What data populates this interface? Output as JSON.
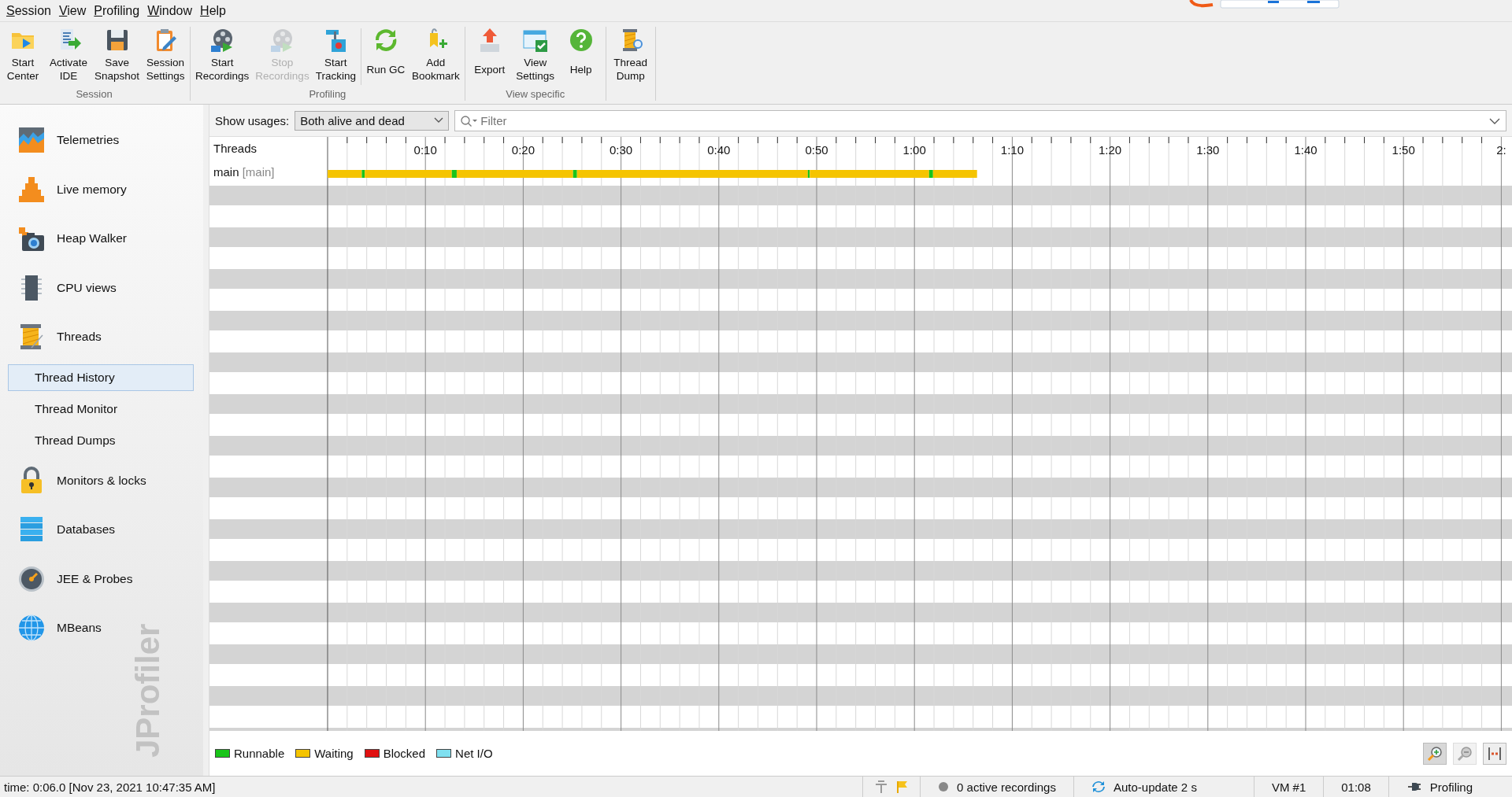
{
  "menu": [
    {
      "label": "Session"
    },
    {
      "label": "View"
    },
    {
      "label": "Profiling"
    },
    {
      "label": "Window"
    },
    {
      "label": "Help"
    }
  ],
  "toolbar": {
    "groups": [
      {
        "label": "Session",
        "buttons": [
          {
            "lines": [
              "Start",
              "Center"
            ],
            "disabled": false
          },
          {
            "lines": [
              "Activate",
              "IDE"
            ],
            "disabled": false
          },
          {
            "lines": [
              "Save",
              "Snapshot"
            ],
            "disabled": false
          },
          {
            "lines": [
              "Session",
              "Settings"
            ],
            "disabled": false
          }
        ]
      },
      {
        "label": "Profiling",
        "buttons": [
          {
            "lines": [
              "Start",
              "Recordings"
            ],
            "disabled": false
          },
          {
            "lines": [
              "Stop",
              "Recordings"
            ],
            "disabled": true
          },
          {
            "lines": [
              "Start",
              "Tracking"
            ],
            "disabled": false
          },
          {
            "lines": [
              "Run GC"
            ],
            "disabled": false
          },
          {
            "lines": [
              "Add",
              "Bookmark"
            ],
            "disabled": false
          }
        ]
      },
      {
        "label": "View specific",
        "buttons": [
          {
            "lines": [
              "Export"
            ],
            "disabled": false
          },
          {
            "lines": [
              "View",
              "Settings"
            ],
            "disabled": false
          },
          {
            "lines": [
              "Help"
            ],
            "disabled": false
          }
        ]
      },
      {
        "buttons": [
          {
            "lines": [
              "Thread",
              "Dump"
            ],
            "disabled": false
          }
        ]
      }
    ]
  },
  "sidebar": {
    "watermark": "JProfiler",
    "items": [
      {
        "label": "Telemetries",
        "selected": false
      },
      {
        "label": "Live memory",
        "selected": false
      },
      {
        "label": "Heap Walker",
        "selected": false
      },
      {
        "label": "CPU views",
        "selected": false
      },
      {
        "label": "Threads",
        "selected": false,
        "children": [
          {
            "label": "Thread History",
            "selected": true
          },
          {
            "label": "Thread Monitor",
            "selected": false
          },
          {
            "label": "Thread Dumps",
            "selected": false
          }
        ]
      },
      {
        "label": "Monitors & locks",
        "selected": false
      },
      {
        "label": "Databases",
        "selected": false
      },
      {
        "label": "JEE & Probes",
        "selected": false
      },
      {
        "label": "MBeans",
        "selected": false
      }
    ]
  },
  "filter_bar": {
    "label": "Show usages:",
    "dropdown": "Both alive and dead",
    "filter": {
      "placeholder": "Filter"
    }
  },
  "threads": {
    "header": "Threads",
    "time_labels": [
      "0:10",
      "0:20",
      "0:30",
      "0:40",
      "0:50",
      "1:00",
      "1:10",
      "1:20",
      "1:30",
      "1:40",
      "1:50",
      "2:"
    ],
    "rows": [
      {
        "name": "main",
        "group": "[main]"
      }
    ]
  },
  "legend": [
    {
      "label": "Runnable",
      "color": "#19c419"
    },
    {
      "label": "Waiting",
      "color": "#f5c400"
    },
    {
      "label": "Blocked",
      "color": "#e01010"
    },
    {
      "label": "Net I/O",
      "color": "#7fe0f0"
    }
  ],
  "zoom_buttons": [
    {
      "kind": "zoom-in",
      "disabled": false
    },
    {
      "kind": "zoom-out",
      "disabled": true
    },
    {
      "kind": "fit",
      "disabled": false
    }
  ],
  "status_bar": {
    "time": "time: 0:06.0 [Nov 23, 2021 10:47:35 AM]",
    "recordings": "0 active recordings",
    "auto_update": "Auto-update 2 s",
    "vm": "VM #1",
    "elapsed": "01:08",
    "mode": "Profiling"
  }
}
